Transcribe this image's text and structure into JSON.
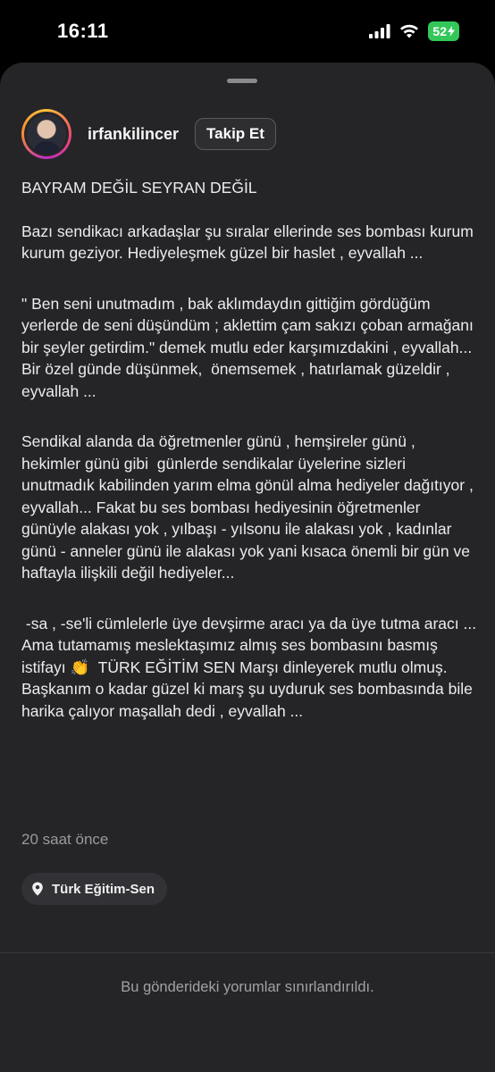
{
  "status_bar": {
    "time": "16:11",
    "battery": "52"
  },
  "post": {
    "username": "irfankilincer",
    "follow_label": "Takip Et",
    "caption_paragraphs": [
      "BAYRAM DEĞİL SEYRAN DEĞİL",
      "Bazı sendikacı arkadaşlar şu sıralar ellerinde ses bombası kurum kurum geziyor. Hediyeleşmek güzel bir haslet , eyvallah ...",
      "\" Ben seni unutmadım , bak aklımdaydın gittiğim gördüğüm yerlerde de seni düşündüm ; aklettim çam sakızı çoban armağanı bir şeyler getirdim.\" demek mutlu eder karşımızdakini , eyvallah... Bir özel günde düşünmek,  önemsemek , hatırlamak güzeldir , eyvallah ...",
      "Sendikal alanda da öğretmenler günü , hemşireler günü , hekimler günü gibi  günlerde sendikalar üyelerine sizleri unutmadık kabilinden yarım elma gönül alma hediyeler dağıtıyor , eyvallah... Fakat bu ses bombası hediyesinin öğretmenler günüyle alakası yok , yılbaşı - yılsonu ile alakası yok , kadınlar günü - anneler günü ile alakası yok yani kısaca önemli bir gün ve haftayla ilişkili değil hediyeler...",
      " -sa , -se'li cümlelerle üye devşirme aracı ya da üye tutma aracı ... Ama tutamamış meslektaşımız almış ses bombasını basmış istifayı 👏  TÜRK EĞİTİM SEN Marşı dinleyerek mutlu olmuş. Başkanım o kadar güzel ki marş şu uyduruk ses bombasında bile harika çalıyor maşallah dedi , eyvallah ..."
    ],
    "timestamp": "20 saat önce",
    "location": "Türk Eğitim-Sen"
  },
  "comments_note": "Bu gönderideki yorumlar sınırlandırıldı."
}
